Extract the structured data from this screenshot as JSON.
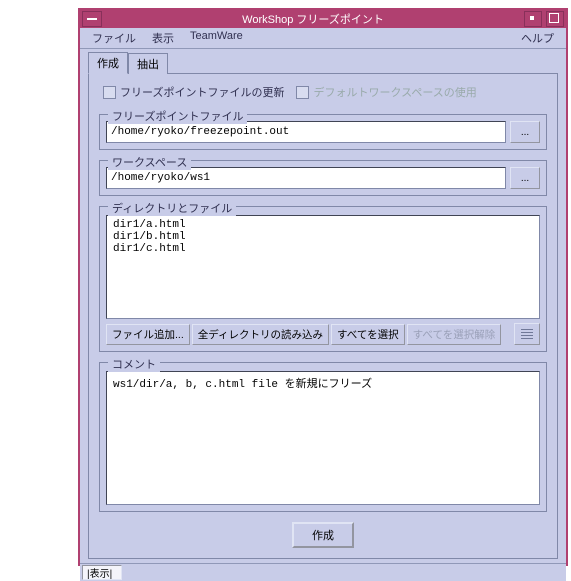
{
  "title": "WorkShop フリーズポイント",
  "menu": {
    "file": "ファイル",
    "view": "表示",
    "teamware": "TeamWare",
    "help": "ヘルプ"
  },
  "tabs": {
    "create": "作成",
    "extract": "抽出"
  },
  "checks": {
    "update": "フリーズポイントファイルの更新",
    "default_ws": "デフォルトワークスペースの使用"
  },
  "fieldsets": {
    "freeze_file": "フリーズポイントファイル",
    "workspace": "ワークスペース",
    "dir_files": "ディレクトリとファイル",
    "comment": "コメント"
  },
  "inputs": {
    "freeze_path": "/home/ryoko/freezepoint.out",
    "workspace_path": "/home/ryoko/ws1"
  },
  "files": "dir1/a.html\ndir1/b.html\ndir1/c.html",
  "buttons": {
    "file_add": "ファイル追加...",
    "read_all_dirs": "全ディレクトリの読み込み",
    "select_all": "すべてを選択",
    "deselect_all": "すべてを選択解除",
    "dots": "...",
    "create": "作成"
  },
  "comment": "ws1/dir/a, b, c.html file を新規にフリーズ",
  "status": "|表示|"
}
